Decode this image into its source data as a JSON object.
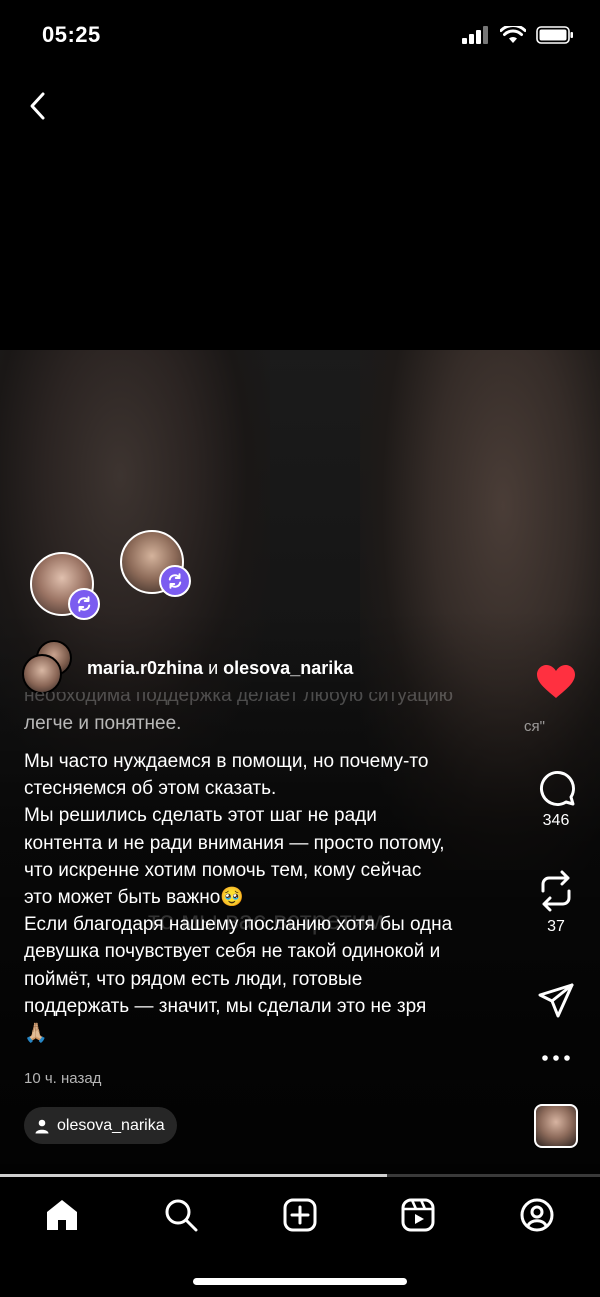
{
  "status_bar": {
    "time": "05:25"
  },
  "post": {
    "author_primary": "maria.r0zhina",
    "author_joiner": "и",
    "author_secondary": "olesova_narika",
    "caption_faded_top": "необходима поддержка делает любую ситуацию",
    "caption_faded_line2": "легче и понятнее.",
    "caption": "Мы часто нуждаемся в помощи, но почему-то\nстесняемся об этом сказать.\nМы решились сделать этот шаг не ради\nконтента и не ради внимания — просто потому,\nчто искренне хотим помочь тем, кому сейчас\nэто может быть важно🥹\nЕсли благодаря нашему посланию хотя бы одна\nдевушка почувствует себя не такой одинокой и\nпоймёт, что рядом есть люди, готовые\nподдержать — значит, мы сделали это не зря\n🙏🏼",
    "time_ago": "10 ч. назад",
    "tagged_user": "olesova_narika",
    "video_overlay_text": "то мы вас встретим",
    "side_overlay_text": "ся\"",
    "progress": 0.645
  },
  "actions": {
    "like_icon": "heart-filled-icon",
    "comments_count": "346",
    "reposts_count": "37",
    "share_icon": "paper-plane-icon",
    "more_icon": "more-dots-icon"
  },
  "tab_bar": [
    "home-icon",
    "search-icon",
    "create-icon",
    "reels-icon",
    "profile-icon"
  ],
  "colors": {
    "like": "#ff3040",
    "repost_badge": "#7b5cf0",
    "background": "#000000"
  }
}
